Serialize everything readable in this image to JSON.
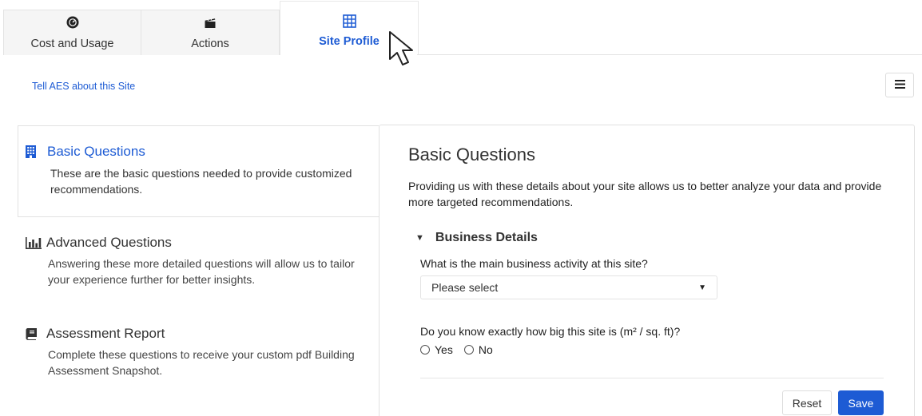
{
  "tabs": [
    {
      "label": "Cost and Usage",
      "icon": "gauge-icon",
      "active": false
    },
    {
      "label": "Actions",
      "icon": "clapperboard-icon",
      "active": false
    },
    {
      "label": "Site Profile",
      "icon": "building-grid-icon",
      "active": true
    }
  ],
  "header": {
    "subtitle": "Tell AES about this Site",
    "menu_icon": "hamburger-menu-icon"
  },
  "sidebar": {
    "items": [
      {
        "title": "Basic Questions",
        "icon": "building-icon",
        "description": "These are the basic questions needed to provide customized recommendations.",
        "active": true
      },
      {
        "title": "Advanced Questions",
        "icon": "bar-chart-icon",
        "description": "Answering these more detailed questions will allow us to tailor your experience further for better insights.",
        "active": false
      },
      {
        "title": "Assessment Report",
        "icon": "book-icon",
        "description": "Complete these questions to receive your custom pdf Building Assessment Snapshot.",
        "active": false
      }
    ]
  },
  "main": {
    "title": "Basic Questions",
    "description": "Providing us with these details about your site allows us to better analyze your data and provide more targeted recommendations.",
    "section": {
      "title": "Business Details",
      "question1": "What is the main business activity at this site?",
      "select_value": "Please select",
      "question2": "Do you know exactly how big this site is (m² / sq. ft)?",
      "options": [
        "Yes",
        "No"
      ]
    },
    "buttons": {
      "reset": "Reset",
      "save": "Save"
    }
  },
  "colors": {
    "accent": "#1d5bd4"
  }
}
